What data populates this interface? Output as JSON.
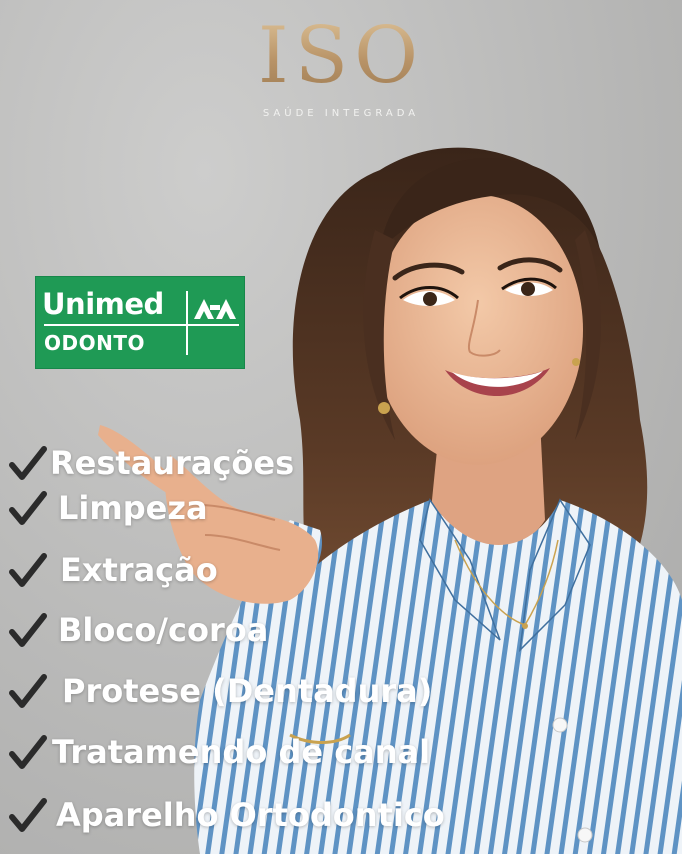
{
  "brand": {
    "mark": "ISO",
    "tagline": "SAÚDE INTEGRADA",
    "gold": "#c2a27a"
  },
  "partner_logo": {
    "word": "Unimed",
    "sub": "ODONTO",
    "color": "#1f9a55"
  },
  "services": [
    {
      "label": "Restaurações",
      "icon": "check-icon"
    },
    {
      "label": "Limpeza",
      "icon": "check-icon"
    },
    {
      "label": "Extração",
      "icon": "check-icon"
    },
    {
      "label": "Bloco/coroa",
      "icon": "check-icon"
    },
    {
      "label": "Protese (Dentadura)",
      "icon": "check-icon"
    },
    {
      "label": "Tratamendo de canal",
      "icon": "check-icon"
    },
    {
      "label": "Aparelho Ortodontico",
      "icon": "check-icon"
    }
  ],
  "colors": {
    "background": "#b9b9b8",
    "text": "#ffffff",
    "check": "#2b2b2b",
    "shirt_stripe": "#5f93c4"
  }
}
